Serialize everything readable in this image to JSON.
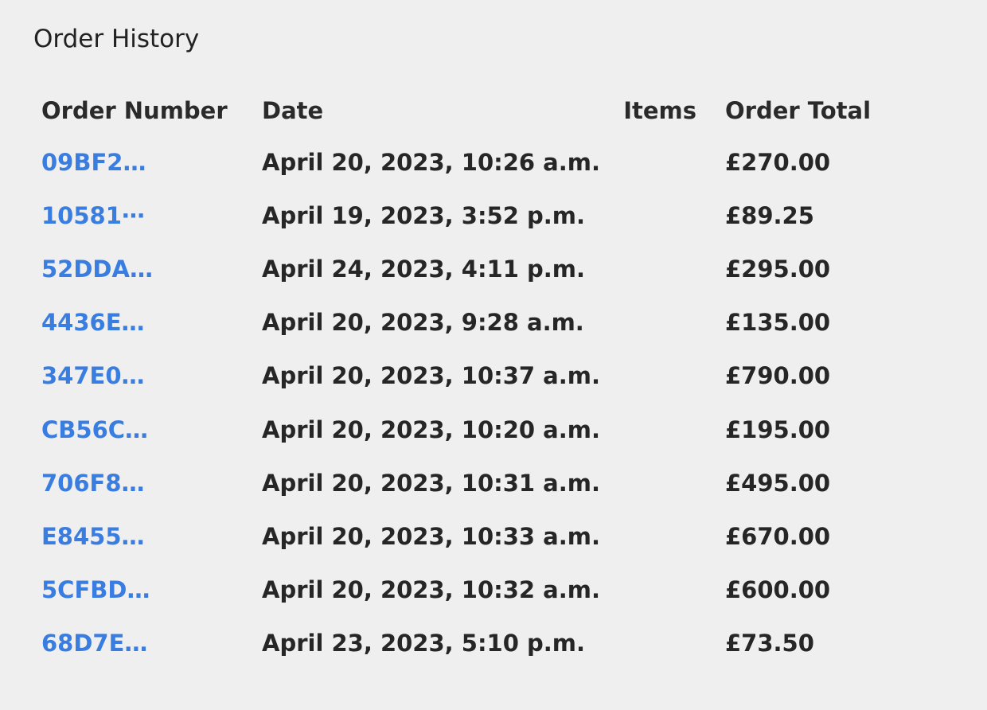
{
  "panel": {
    "title": "Order History"
  },
  "table": {
    "columns": [
      "Order Number",
      "Date",
      "Items",
      "Order Total"
    ],
    "rows": [
      {
        "order_number": "09BF2…",
        "date": "April 20, 2023, 10:26 a.m.",
        "items": "",
        "total": "£270.00"
      },
      {
        "order_number": "10581⋯",
        "date": "April 19, 2023, 3:52 p.m.",
        "items": "",
        "total": "£89.25"
      },
      {
        "order_number": "52DDA…",
        "date": "April 24, 2023, 4:11 p.m.",
        "items": "",
        "total": "£295.00"
      },
      {
        "order_number": "4436E…",
        "date": "April 20, 2023, 9:28 a.m.",
        "items": "",
        "total": "£135.00"
      },
      {
        "order_number": "347E0…",
        "date": "April 20, 2023, 10:37 a.m.",
        "items": "",
        "total": "£790.00"
      },
      {
        "order_number": "CB56C…",
        "date": "April 20, 2023, 10:20 a.m.",
        "items": "",
        "total": "£195.00"
      },
      {
        "order_number": "706F8…",
        "date": "April 20, 2023, 10:31 a.m.",
        "items": "",
        "total": "£495.00"
      },
      {
        "order_number": "E8455…",
        "date": "April 20, 2023, 10:33 a.m.",
        "items": "",
        "total": "£670.00"
      },
      {
        "order_number": "5CFBD…",
        "date": "April 20, 2023, 10:32 a.m.",
        "items": "",
        "total": "£600.00"
      },
      {
        "order_number": "68D7E…",
        "date": "April 23, 2023, 5:10 p.m.",
        "items": "",
        "total": "£73.50"
      }
    ]
  },
  "colors": {
    "background": "#efefef",
    "text": "#222222",
    "link": "#3a7de1"
  }
}
